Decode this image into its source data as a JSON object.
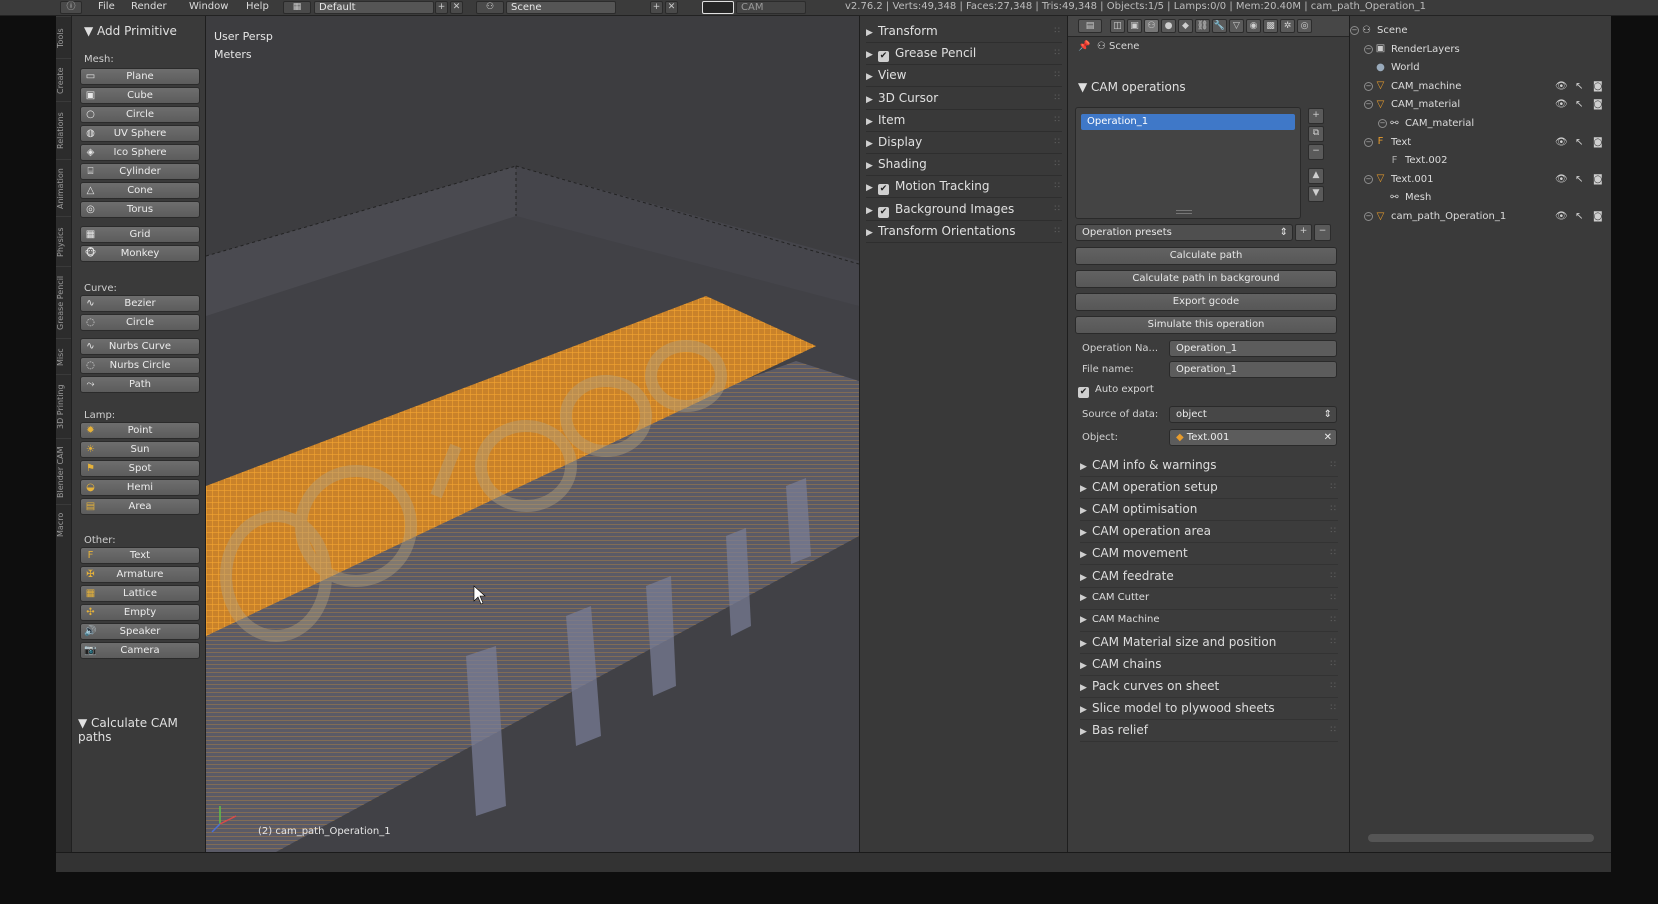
{
  "topbar": {
    "menus": [
      "File",
      "Render",
      "Window",
      "Help"
    ],
    "layout": "Default",
    "scene": "Scene",
    "engine": "CAM",
    "info": "v2.76.2 | Verts:49,348 | Faces:27,348 | Tris:49,348 | Objects:1/5 | Lamps:0/0 | Mem:20.40M | cam_path_Operation_1"
  },
  "shelf_tabs": [
    "Tools",
    "Create",
    "Relations",
    "Animation",
    "Physics",
    "Grease Pencil",
    "Misc",
    "3D Printing",
    "Blender CAM",
    "Macro"
  ],
  "toolshelf": {
    "title": "Add Primitive",
    "mesh_label": "Mesh:",
    "mesh": [
      "Plane",
      "Cube",
      "Circle",
      "UV Sphere",
      "Ico Sphere",
      "Cylinder",
      "Cone",
      "Torus",
      "Grid",
      "Monkey"
    ],
    "curve_label": "Curve:",
    "curve": [
      "Bezier",
      "Circle",
      "Nurbs Curve",
      "Nurbs Circle",
      "Path"
    ],
    "lamp_label": "Lamp:",
    "lamp": [
      "Point",
      "Sun",
      "Spot",
      "Hemi",
      "Area"
    ],
    "other_label": "Other:",
    "other": [
      "Text",
      "Armature",
      "Lattice",
      "Empty",
      "Speaker",
      "Camera"
    ],
    "operator_panel": "Calculate CAM paths"
  },
  "viewport": {
    "view_name": "User Persp",
    "units": "Meters",
    "object_label": "(2) cam_path_Operation_1",
    "toolpath_color": "#f0a030",
    "block_color": "#5c5c66"
  },
  "npanel": [
    {
      "label": "Transform",
      "check": false
    },
    {
      "label": "Grease Pencil",
      "check": true
    },
    {
      "label": "View",
      "check": false
    },
    {
      "label": "3D Cursor",
      "check": false
    },
    {
      "label": "Item",
      "check": false
    },
    {
      "label": "Display",
      "check": false
    },
    {
      "label": "Shading",
      "check": false
    },
    {
      "label": "Motion Tracking",
      "check": true
    },
    {
      "label": "Background Images",
      "check": true
    },
    {
      "label": "Transform Orientations",
      "check": false
    }
  ],
  "props": {
    "context": "Scene",
    "operations_title": "CAM operations",
    "operation_selected": "Operation_1",
    "presets": "Operation presets",
    "buttons": [
      "Calculate path",
      "Calculate path in background",
      "Export gcode",
      "Simulate this operation"
    ],
    "op_name_label": "Operation Na...",
    "op_name_value": "Operation_1",
    "file_name_label": "File name:",
    "file_name_value": "Operation_1",
    "auto_export": "Auto export",
    "source_label": "Source of data:",
    "source_value": "object",
    "object_label": "Object:",
    "object_value": "Text.001",
    "sections": [
      "CAM info & warnings",
      "CAM operation setup",
      "CAM optimisation",
      "CAM operation area",
      "CAM movement",
      "CAM feedrate",
      "CAM Cutter",
      "CAM Machine",
      "CAM Material size and position",
      "CAM chains",
      "Pack curves on sheet",
      "Slice model to plywood sheets",
      "Bas relief"
    ],
    "selection_color": "#3f78c8"
  },
  "outliner": [
    {
      "label": "Scene",
      "indent": 0,
      "icon": "scene-icon",
      "exp": true
    },
    {
      "label": "RenderLayers",
      "indent": 1,
      "icon": "renderlayers-icon",
      "exp": true
    },
    {
      "label": "World",
      "indent": 1,
      "icon": "world-icon",
      "exp": false
    },
    {
      "label": "CAM_machine",
      "indent": 1,
      "icon": "mesh-object-icon",
      "exp": true
    },
    {
      "label": "CAM_material",
      "indent": 1,
      "icon": "mesh-object-icon",
      "exp": true
    },
    {
      "label": "CAM_material",
      "indent": 2,
      "icon": "mesh-data-icon",
      "exp": true
    },
    {
      "label": "Text",
      "indent": 1,
      "icon": "font-object-icon",
      "exp": true
    },
    {
      "label": "Text.002",
      "indent": 2,
      "icon": "font-data-icon",
      "exp": false
    },
    {
      "label": "Text.001",
      "indent": 1,
      "icon": "mesh-object-icon",
      "exp": true
    },
    {
      "label": "Mesh",
      "indent": 2,
      "icon": "mesh-data-icon",
      "exp": false
    },
    {
      "label": "cam_path_Operation_1",
      "indent": 1,
      "icon": "mesh-object-icon",
      "exp": true
    }
  ]
}
